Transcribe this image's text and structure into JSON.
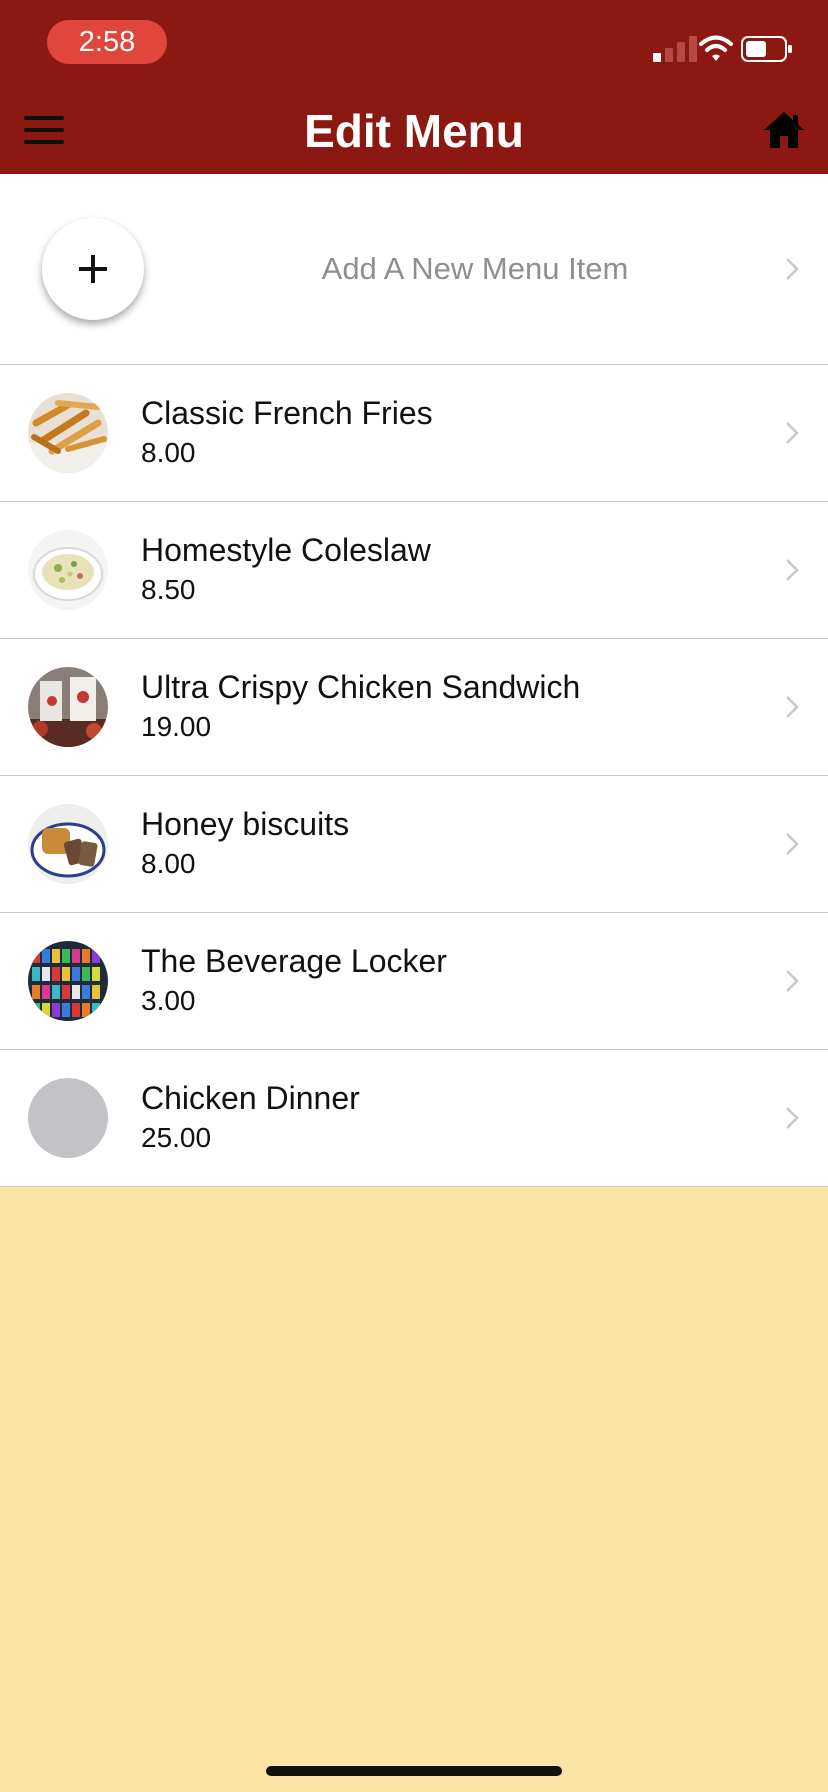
{
  "status_bar": {
    "time": "2:58",
    "signal_icon": "signal-icon",
    "wifi_icon": "wifi-icon",
    "battery_icon": "battery-icon"
  },
  "header": {
    "title": "Edit Menu",
    "menu_icon": "hamburger-menu-icon",
    "home_icon": "home-icon"
  },
  "add_item": {
    "label": "Add A New Menu Item",
    "icon": "plus-icon"
  },
  "items": [
    {
      "name": "Classic French Fries",
      "price": "8.00",
      "image": "french-fries"
    },
    {
      "name": "Homestyle Coleslaw",
      "price": "8.50",
      "image": "coleslaw"
    },
    {
      "name": "Ultra Crispy Chicken Sandwich",
      "price": "19.00",
      "image": "chicken-sandwich"
    },
    {
      "name": "Honey biscuits",
      "price": "8.00",
      "image": "honey-biscuits"
    },
    {
      "name": "The Beverage Locker",
      "price": "3.00",
      "image": "beverage-cooler"
    },
    {
      "name": "Chicken Dinner",
      "price": "25.00",
      "image": "placeholder"
    }
  ],
  "colors": {
    "header_bg": "#8c1812",
    "time_pill": "#e0463c",
    "page_bg": "#f9e4a5",
    "list_bg": "#ffffff",
    "separator": "#c8c8cc",
    "secondary_text": "#8e8e93"
  }
}
